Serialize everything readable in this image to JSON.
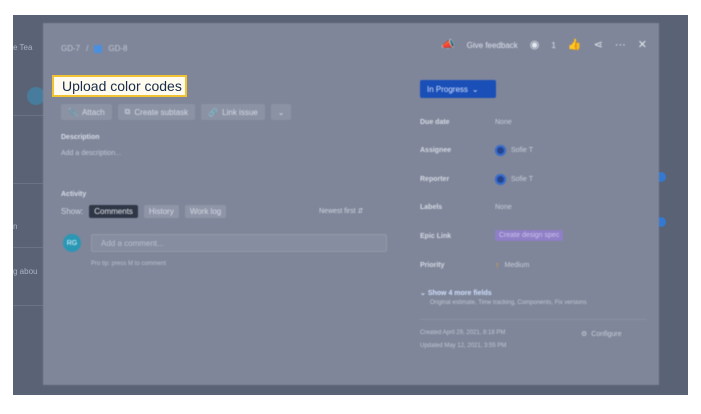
{
  "backdrop": {
    "left_texts": [
      "e Tea",
      "n",
      "g abou"
    ]
  },
  "header": {
    "breadcrumb_parent": "GD-7",
    "breadcrumb_sep": "/",
    "breadcrumb_issue": "GD-8",
    "feedback_label": "Give feedback",
    "watchers_count": "1"
  },
  "issue": {
    "title": "Upload color codes"
  },
  "toolbar": {
    "attach_label": "Attach",
    "create_subtask_label": "Create subtask",
    "link_issue_label": "Link issue"
  },
  "description": {
    "heading": "Description",
    "placeholder": "Add a description..."
  },
  "activity": {
    "heading": "Activity",
    "show_label": "Show:",
    "tabs": [
      "Comments",
      "History",
      "Work log"
    ],
    "sort_label": "Newest first ⇵"
  },
  "comment": {
    "avatar_initials": "RG",
    "placeholder": "Add a comment...",
    "protip": "Pro tip: press M to comment"
  },
  "details": {
    "status": "In Progress",
    "fields": [
      {
        "label": "Due date",
        "value": "None"
      },
      {
        "label": "Assignee",
        "value": "Sofie T"
      },
      {
        "label": "Reporter",
        "value": "Sofie T"
      },
      {
        "label": "Labels",
        "value": "None"
      },
      {
        "label": "Epic Link",
        "value": "Create design spec"
      },
      {
        "label": "Priority",
        "value": "Medium"
      }
    ],
    "show_more": "Show 4 more fields",
    "show_more_sub": "Original estimate, Time tracking, Components, Fix versions",
    "created": "Created April 29, 2021, 8:18 PM",
    "updated": "Updated May 12, 2021, 3:55 PM",
    "configure": "Configure"
  },
  "colors": {
    "highlight_border": "#f1c232",
    "status_blue": "#1a4fb8",
    "priority_orange": "#e6a32e"
  }
}
